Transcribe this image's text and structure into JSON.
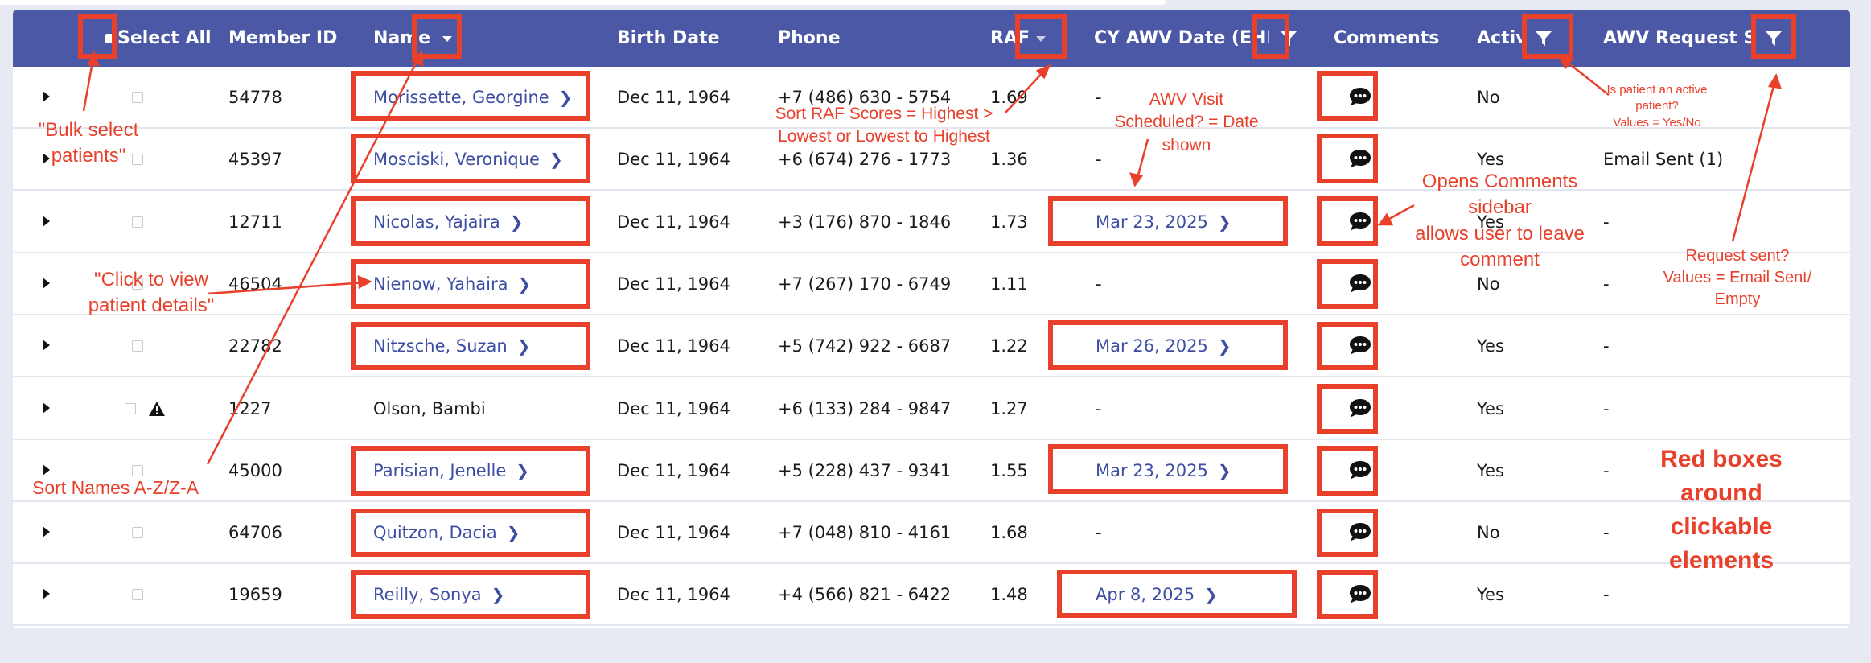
{
  "header": {
    "select_all": "Select All",
    "member_id": "Member ID",
    "name": "Name",
    "birth_date": "Birth Date",
    "phone": "Phone",
    "raf": "RAF",
    "cy_awv_date": "CY AWV Date (EHR)",
    "comments": "Comments",
    "active": "Active",
    "awv_request_sent": "AWV Request Sent"
  },
  "rows": [
    {
      "member_id": "54778",
      "name": "Morissette, Georgine",
      "birth_date": "Dec 11, 1964",
      "phone": "+7 (486) 630 - 5754",
      "raf": "1.69",
      "awv_date": "-",
      "active": "No",
      "request": ""
    },
    {
      "member_id": "45397",
      "name": "Mosciski, Veronique",
      "birth_date": "Dec 11, 1964",
      "phone": "+6 (674) 276 - 1773",
      "raf": "1.36",
      "awv_date": "-",
      "active": "Yes",
      "request": "Email Sent (1)"
    },
    {
      "member_id": "12711",
      "name": "Nicolas, Yajaira",
      "birth_date": "Dec 11, 1964",
      "phone": "+3 (176) 870 - 1846",
      "raf": "1.73",
      "awv_date": "Mar 23, 2025",
      "active": "Yes",
      "request": "-"
    },
    {
      "member_id": "46504",
      "name": "Nienow, Yahaira",
      "birth_date": "Dec 11, 1964",
      "phone": "+7 (267) 170 - 6749",
      "raf": "1.11",
      "awv_date": "-",
      "active": "No",
      "request": "-"
    },
    {
      "member_id": "22782",
      "name": "Nitzsche, Suzan",
      "birth_date": "Dec 11, 1964",
      "phone": "+5 (742) 922 - 6687",
      "raf": "1.22",
      "awv_date": "Mar 26, 2025",
      "active": "Yes",
      "request": "-"
    },
    {
      "member_id": "1227",
      "name": "Olson, Bambi",
      "birth_date": "Dec 11, 1964",
      "phone": "+6 (133) 284 - 9847",
      "raf": "1.27",
      "awv_date": "-",
      "active": "Yes",
      "request": "-"
    },
    {
      "member_id": "45000",
      "name": "Parisian, Jenelle",
      "birth_date": "Dec 11, 1964",
      "phone": "+5 (228) 437 - 9341",
      "raf": "1.55",
      "awv_date": "Mar 23, 2025",
      "active": "Yes",
      "request": "-"
    },
    {
      "member_id": "64706",
      "name": "Quitzon, Dacia",
      "birth_date": "Dec 11, 1964",
      "phone": "+7 (048) 810 - 4161",
      "raf": "1.68",
      "awv_date": "-",
      "active": "No",
      "request": "-"
    },
    {
      "member_id": "19659",
      "name": "Reilly, Sonya",
      "birth_date": "Dec 11, 1964",
      "phone": "+4 (566) 821 - 6422",
      "raf": "1.48",
      "awv_date": "Apr 8, 2025",
      "active": "Yes",
      "request": "-"
    }
  ],
  "annotations": {
    "bulk_select": "\"Bulk select\npatients\"",
    "click_view": "\"Click to view\npatient details\"",
    "sort_names": "Sort Names A-Z/Z-A",
    "sort_raf": "Sort RAF Scores = Highest >\nLowest or Lowest to Highest",
    "awv_visit": "AWV Visit\nScheduled? = Date\nshown",
    "opens_comments": "Opens Comments\nsidebar\nallows user to leave\ncomment",
    "is_active": "Is patient an active\npatient?\nValues = Yes/No",
    "request_sent": "Request sent?\nValues = Email Sent/\nEmpty",
    "red_boxes": "Red boxes\naround\nclickable\nelements"
  },
  "colors": {
    "header_bg": "#4a58a5",
    "link": "#3d4ea3",
    "annotation_red": "#e8402b",
    "page_bg": "#e7eaf2"
  }
}
